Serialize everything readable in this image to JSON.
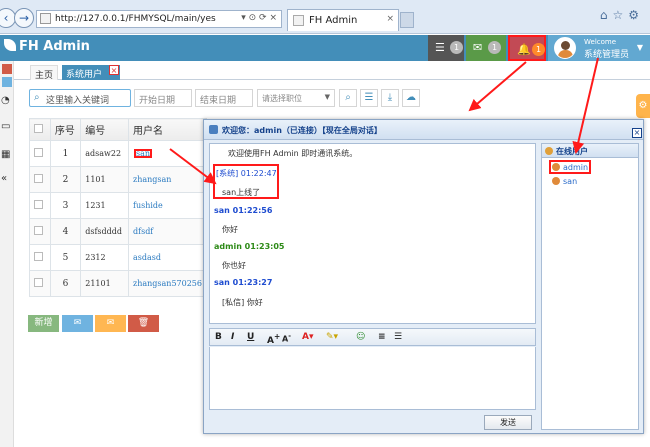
{
  "browser": {
    "url": "http://127.0.0.1/FHMYSQL/main/yes",
    "url_controls": "▾ ⊙ ⟳ ×",
    "tab_title": "FH Admin"
  },
  "header": {
    "brand": "FH Admin",
    "tasks_badge": "1",
    "mail_badge": "1",
    "bell_badge": "1",
    "welcome": "Welcome",
    "user_name": "系统管理员"
  },
  "tabs": {
    "home": "主页",
    "users": "系统用户"
  },
  "search": {
    "placeholder": "这里输入关键词",
    "start_date": "开始日期",
    "end_date": "结束日期",
    "role_select": "请选择职位"
  },
  "table": {
    "headers": [
      "序号",
      "编号",
      "用户名"
    ],
    "rows": [
      {
        "no": "1",
        "code": "adsaw22",
        "user": "san"
      },
      {
        "no": "2",
        "code": "1101",
        "user": "zhangsan"
      },
      {
        "no": "3",
        "code": "1231",
        "user": "fushide"
      },
      {
        "no": "4",
        "code": "dsfsdddd",
        "user": "dfsdf"
      },
      {
        "no": "5",
        "code": "2312",
        "user": "asdasd"
      },
      {
        "no": "6",
        "code": "21101",
        "user": "zhangsan570256"
      }
    ]
  },
  "actions": {
    "add": "新增"
  },
  "chat": {
    "title": "欢迎您：admin（已连接）【现在全局对话】",
    "welcome_text": "欢迎使用FH Admin 即时通讯系统。",
    "messages": [
      {
        "head": "[系统] 01:22:47",
        "body": "san上线了"
      },
      {
        "head": "san 01:22:56",
        "body": "你好"
      },
      {
        "head": "admin 01:23:05",
        "body": "你也好"
      },
      {
        "head": "san 01:23:27",
        "body": "[私信] 你好"
      }
    ],
    "send_label": "发送",
    "online_title": "在线用户",
    "online_users": [
      "admin",
      "san"
    ]
  },
  "colors": {
    "header_bg": "#438eb9",
    "highlight": "#ff1a1a",
    "chat_border": "#8aa4c4"
  }
}
